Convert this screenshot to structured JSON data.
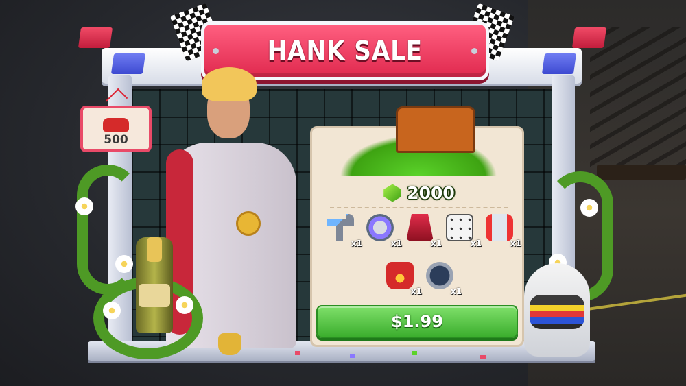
{
  "title": "HANK SALE",
  "price_tag": {
    "value": "500"
  },
  "offer": {
    "gems": "2000",
    "items": [
      {
        "name": "hammer",
        "qty": "x1"
      },
      {
        "name": "saw",
        "qty": "x1"
      },
      {
        "name": "press",
        "qty": "x1"
      },
      {
        "name": "dice",
        "qty": "x1"
      },
      {
        "name": "spring",
        "qty": "x1"
      },
      {
        "name": "fire-can",
        "qty": "x1"
      },
      {
        "name": "gauge",
        "qty": "x1"
      }
    ],
    "price": "$1.99"
  },
  "colors": {
    "banner": "#e0294e",
    "buy_button": "#3cae2e",
    "gems": "#5bd32a",
    "panel": "#f2e6d4"
  }
}
